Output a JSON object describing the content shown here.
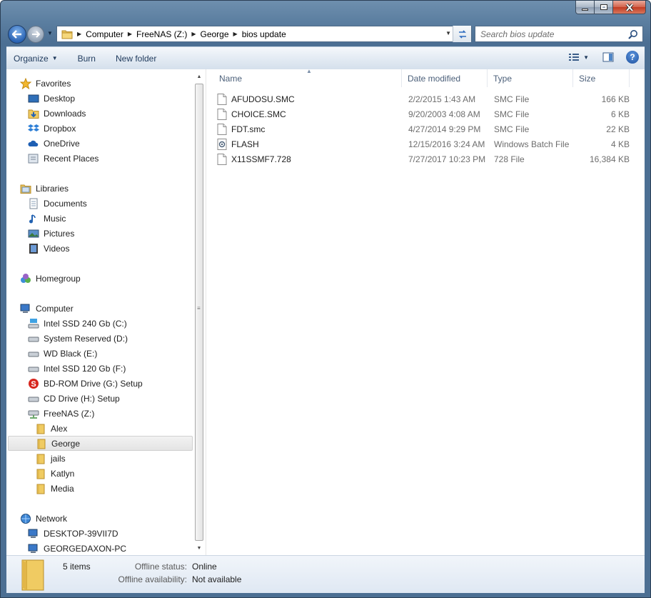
{
  "window": {
    "caption_buttons": [
      "minimize",
      "maximize",
      "close"
    ]
  },
  "address": {
    "crumbs": [
      "Computer",
      "FreeNAS (Z:)",
      "George",
      "bios update"
    ]
  },
  "search": {
    "placeholder": "Search bios update"
  },
  "toolbar": {
    "organize": "Organize",
    "burn": "Burn",
    "new_folder": "New folder"
  },
  "nav": {
    "favorites": {
      "header": "Favorites",
      "items": [
        "Desktop",
        "Downloads",
        "Dropbox",
        "OneDrive",
        "Recent Places"
      ]
    },
    "libraries": {
      "header": "Libraries",
      "items": [
        "Documents",
        "Music",
        "Pictures",
        "Videos"
      ]
    },
    "homegroup": "Homegroup",
    "computer": {
      "header": "Computer",
      "drives": [
        "Intel SSD 240 Gb (C:)",
        "System Reserved (D:)",
        "WD Black (E:)",
        "Intel SSD 120 Gb (F:)",
        "BD-ROM Drive (G:) Setup",
        "CD Drive (H:) Setup",
        "FreeNAS (Z:)"
      ],
      "folders": [
        "Alex",
        "George",
        "jails",
        "Katlyn",
        "Media"
      ],
      "selected": "George"
    },
    "network": {
      "header": "Network",
      "items": [
        "DESKTOP-39VII7D",
        "GEORGEDAXON-PC"
      ]
    }
  },
  "columns": {
    "name": "Name",
    "date": "Date modified",
    "type": "Type",
    "size": "Size"
  },
  "files": [
    {
      "name": "AFUDOSU.SMC",
      "date": "2/2/2015 1:43 AM",
      "type": "SMC File",
      "size": "166 KB",
      "icon": "generic-file-icon"
    },
    {
      "name": "CHOICE.SMC",
      "date": "9/20/2003 4:08 AM",
      "type": "SMC File",
      "size": "6 KB",
      "icon": "generic-file-icon"
    },
    {
      "name": "FDT.smc",
      "date": "4/27/2014 9:29 PM",
      "type": "SMC File",
      "size": "22 KB",
      "icon": "generic-file-icon"
    },
    {
      "name": "FLASH",
      "date": "12/15/2016 3:24 AM",
      "type": "Windows Batch File",
      "size": "4 KB",
      "icon": "batch-file-icon"
    },
    {
      "name": "X11SSMF7.728",
      "date": "7/27/2017 10:23 PM",
      "type": "728 File",
      "size": "16,384 KB",
      "icon": "generic-file-icon"
    }
  ],
  "details": {
    "count": "5 items",
    "offline_status_label": "Offline status:",
    "offline_status_value": "Online",
    "offline_avail_label": "Offline availability:",
    "offline_avail_value": "Not available"
  },
  "colors": {
    "frame": "#5b7ea0",
    "toolbar_text": "#1e395b",
    "selection": "#e4e4e4"
  }
}
